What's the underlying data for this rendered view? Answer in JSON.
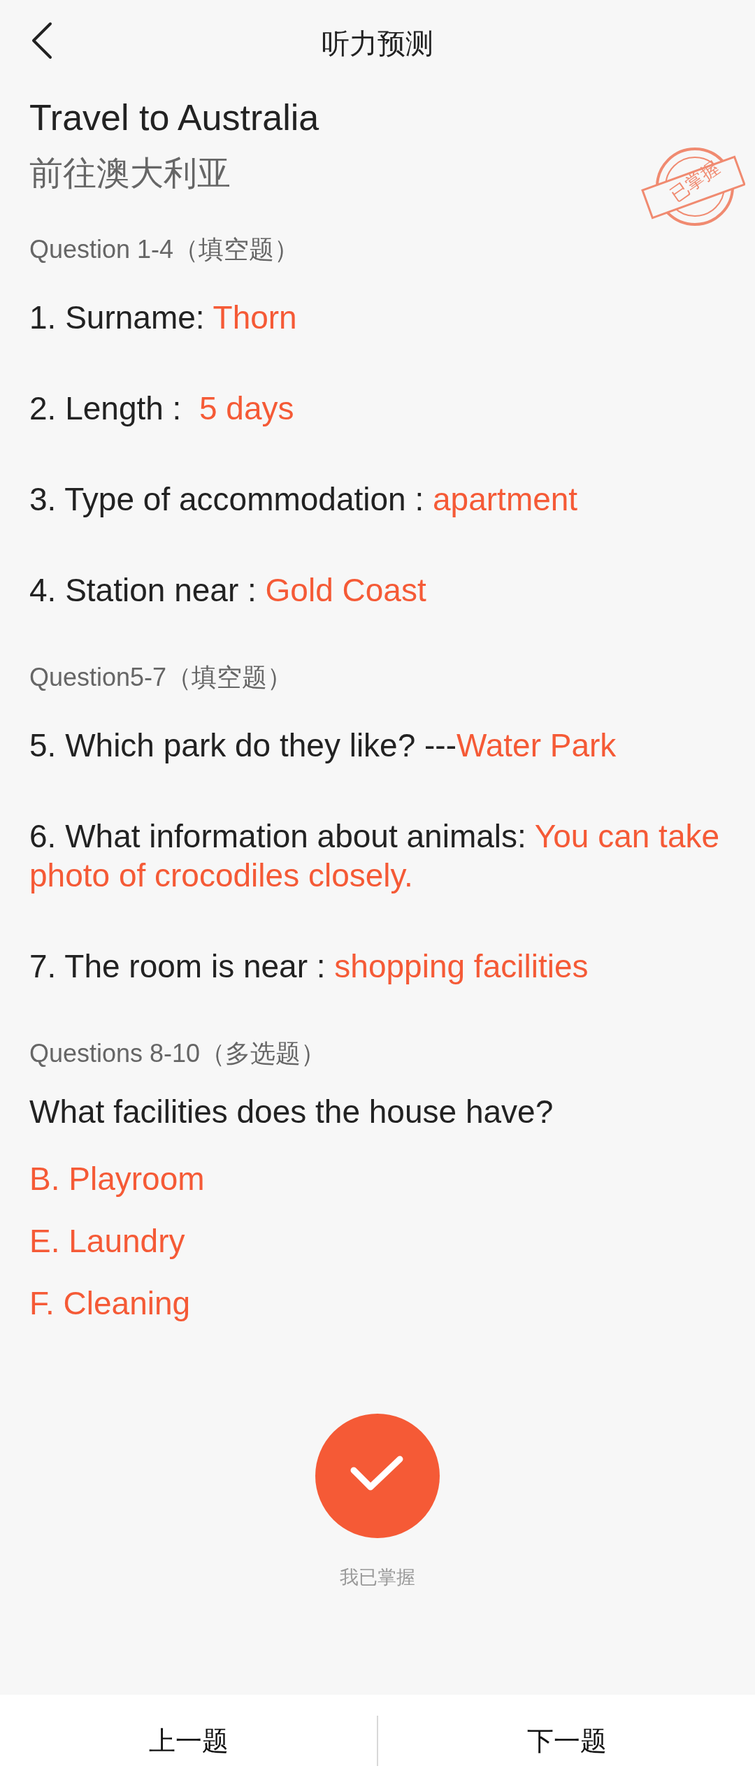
{
  "header": {
    "title": "听力预测"
  },
  "lesson": {
    "title": "Travel to Australia",
    "subtitle": "前往澳大利亚",
    "stamp": "已掌握"
  },
  "sections": [
    {
      "heading": "Question 1-4（填空题）",
      "items": [
        {
          "label": "1. Surname: ",
          "answer": "Thorn"
        },
        {
          "label": "2. Length :  ",
          "answer": "5 days"
        },
        {
          "label": "3. Type of accommodation : ",
          "answer": "apartment"
        },
        {
          "label": "4. Station near : ",
          "answer": "Gold Coast"
        }
      ]
    },
    {
      "heading": "Question5-7（填空题）",
      "items": [
        {
          "label": "5. Which park do they like? ---",
          "answer": "Water Park"
        },
        {
          "label": "6. What information about animals: ",
          "answer": "You can take photo of crocodiles closely."
        },
        {
          "label": "7. The room is near : ",
          "answer": "shopping facilities"
        }
      ]
    },
    {
      "heading": "Questions 8-10（多选题）",
      "prompt": "What facilities does the house have?",
      "options": [
        "B. Playroom",
        "E. Laundry",
        "F. Cleaning"
      ]
    }
  ],
  "mastered": {
    "on": true,
    "label": "我已掌握"
  },
  "footer": {
    "prev": "上一题",
    "next": "下一题"
  }
}
